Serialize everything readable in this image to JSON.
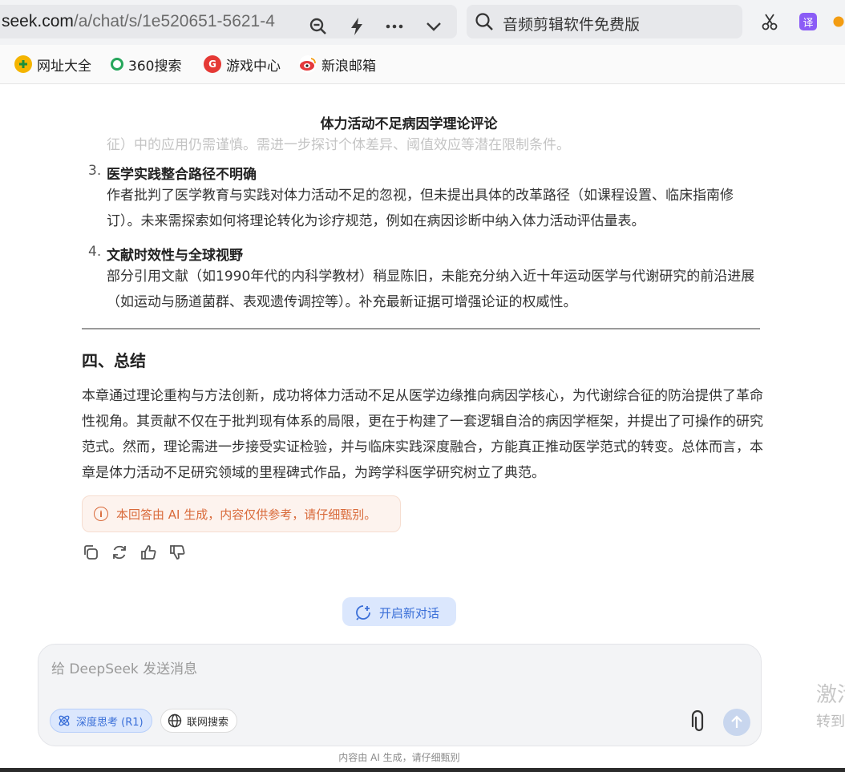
{
  "browser": {
    "url_main": "seek.com",
    "url_path": "/a/chat/s/1e520651-5621-4",
    "search_text": "音频剪辑软件免费版",
    "translate_label": "译"
  },
  "bookmarks": [
    {
      "label": "网址大全",
      "icon": "plus-circle-icon",
      "color": "#f4b400"
    },
    {
      "label": "360搜索",
      "icon": "ring-icon",
      "color": "#26a65b"
    },
    {
      "label": "游戏中心",
      "icon": "game-icon",
      "color": "#e53935"
    },
    {
      "label": "新浪邮箱",
      "icon": "weibo-eye-icon",
      "color": "#e4393c"
    }
  ],
  "doc": {
    "title": "体力活动不足病因学理论评论",
    "faded_line": "征）中的应用仍需谨慎。需进一步探讨个体差异、阈值效应等潜在限制条件。",
    "items": [
      {
        "num": "3.",
        "head": "医学实践整合路径不明确",
        "body": "作者批判了医学教育与实践对体力活动不足的忽视，但未提出具体的改革路径（如课程设置、临床指南修订）。未来需探索如何将理论转化为诊疗规范，例如在病因诊断中纳入体力活动评估量表。"
      },
      {
        "num": "4.",
        "head": "文献时效性与全球视野",
        "body": "部分引用文献（如1990年代的内科学教材）稍显陈旧，未能充分纳入近十年运动医学与代谢研究的前沿进展（如运动与肠道菌群、表观遗传调控等）。补充最新证据可增强论证的权威性。"
      }
    ],
    "section_heading": "四、总结",
    "summary": "本章通过理论重构与方法创新，成功将体力活动不足从医学边缘推向病因学核心，为代谢综合征的防治提供了革命性视角。其贡献不仅在于批判现有体系的局限，更在于构建了一套逻辑自洽的病因学框架，并提出了可操作的研究范式。然而，理论需进一步接受实证检验，并与临床实践深度融合，方能真正推动医学范式的转变。总体而言，本章是体力活动不足研究领域的里程碑式作品，为跨学科医学研究树立了典范。",
    "ai_notice": "本回答由 AI 生成，内容仅供参考，请仔细甄别。"
  },
  "new_chat_label": "开启新对话",
  "composer": {
    "placeholder": "给 DeepSeek 发送消息",
    "deep_think_label": "深度思考 (R1)",
    "web_search_label": "联网搜索"
  },
  "footer_note": "内容由 AI 生成，请仔细甄别",
  "side": {
    "line1": "激活",
    "line2": "转到"
  }
}
